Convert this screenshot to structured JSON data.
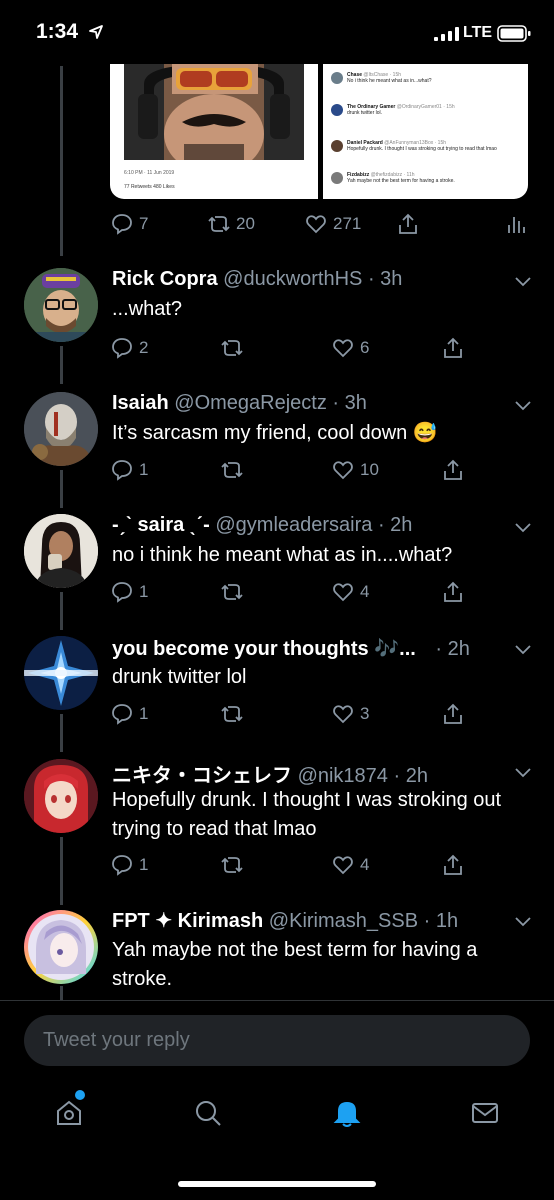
{
  "status_bar": {
    "time": "1:34",
    "network": "LTE"
  },
  "embedded_media": {
    "left_meta": "6:10 PM · 11 Jun 2019",
    "left_counts": "77 Retweets  480 Likes",
    "right_rows": [
      {
        "name": "Chase",
        "handle": "@ItsChase · 15h",
        "text": "No i think he meant what as in...what?"
      },
      {
        "name": "The Ordinary Gamer",
        "handle": "@OrdinaryGamer01 · 15h",
        "text": "drunk twitter lol."
      },
      {
        "name": "Daniel Packard",
        "handle": "@AnFunnyman13Box · 15h",
        "text": "Hopefully drunk. I thought I was stroking out trying to read that lmao"
      },
      {
        "name": "Fizdabizz",
        "handle": "@thefizdabizz · 11h",
        "text": "Yah maybe not the best term for having a stroke."
      }
    ]
  },
  "top_tweet": {
    "replies": "7",
    "retweets": "20",
    "likes": "271"
  },
  "replies": [
    {
      "name": "Rick Copra",
      "handle": "@duckworthHS",
      "time": "· 3h",
      "text": "...what?",
      "reply_count": "2",
      "retweet_count": "",
      "like_count": "6"
    },
    {
      "name": "Isaiah",
      "handle": "@OmegaRejectz",
      "time": "· 3h",
      "text": "It’s sarcasm my friend, cool down 😅",
      "reply_count": "1",
      "retweet_count": "",
      "like_count": "10"
    },
    {
      "name": "-ˏˋ saira ˎˊ-",
      "handle": "@gymleadersaira",
      "time": "· 2h",
      "text": "no i think he meant what as in....what?",
      "reply_count": "1",
      "retweet_count": "",
      "like_count": "4"
    },
    {
      "name": "you become your thoughts 🎶...",
      "handle": "",
      "time": "· 2h",
      "text": "drunk twitter lol",
      "reply_count": "1",
      "retweet_count": "",
      "like_count": "3"
    },
    {
      "name": "ニキタ・コシェレフ",
      "handle": "@nik1874",
      "time": "· 2h",
      "text": "Hopefully drunk. I thought I was stroking out trying to read that lmao",
      "reply_count": "1",
      "retweet_count": "",
      "like_count": "4"
    },
    {
      "name": "FPT ✦ Kirimash",
      "handle": "@Kirimash_SSB",
      "time": "· 1h",
      "text": "Yah maybe not the best term for having a stroke.",
      "reply_count": "",
      "retweet_count": "",
      "like_count": ""
    }
  ],
  "compose": {
    "placeholder": "Tweet your reply"
  },
  "tab_bar": [
    {
      "icon": "home-icon"
    },
    {
      "icon": "search-icon"
    },
    {
      "icon": "notifications-icon"
    },
    {
      "icon": "messages-icon"
    }
  ],
  "colors": {
    "accent": "#1da1f2",
    "muted": "#8b98a5",
    "background": "#000000"
  }
}
